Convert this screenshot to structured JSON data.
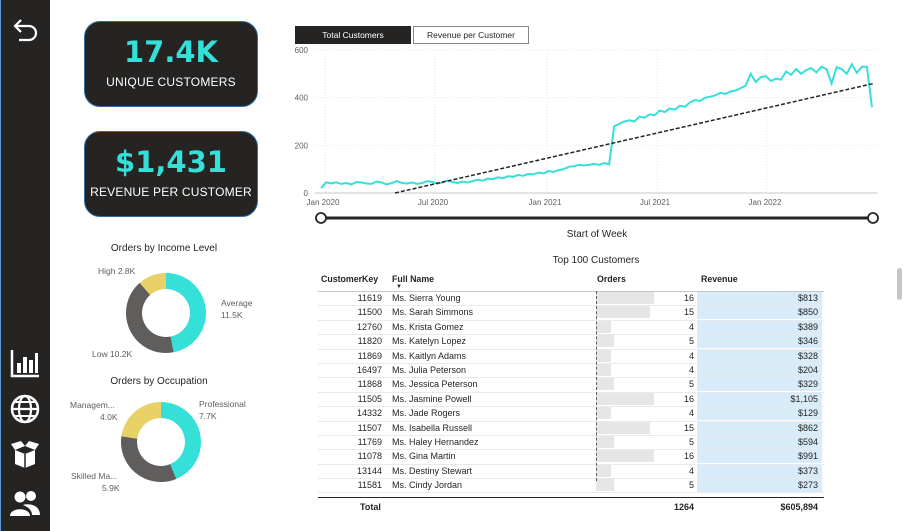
{
  "kpis": {
    "unique_customers": {
      "value": "17.4K",
      "label": "UNIQUE CUSTOMERS"
    },
    "revenue_per_customer": {
      "value": "$1,431",
      "label": "REVENUE PER CUSTOMER"
    }
  },
  "income": {
    "title": "Orders by Income Level",
    "slices": [
      {
        "name": "Average",
        "value": "11.5K",
        "num": 11.5,
        "color": "#35e0d8"
      },
      {
        "name": "Low",
        "value": "10.2K",
        "num": 10.2,
        "color": "#605e5c"
      },
      {
        "name": "High",
        "value": "2.8K",
        "num": 2.8,
        "color": "#e8d166"
      }
    ],
    "labels": {
      "average": "Average",
      "average_val": "11.5K",
      "low": "Low 10.2K",
      "high": "High 2.8K"
    }
  },
  "occupation": {
    "title": "Orders by Occupation",
    "slices": [
      {
        "name": "Professional",
        "value": "7.7K",
        "num": 7.7,
        "color": "#35e0d8"
      },
      {
        "name": "Skilled Ma...",
        "value": "5.9K",
        "num": 5.9,
        "color": "#605e5c"
      },
      {
        "name": "Managem...",
        "value": "4.0K",
        "num": 4.0,
        "color": "#e8d166"
      }
    ],
    "labels": {
      "professional": "Professional",
      "professional_val": "7.7K",
      "skilled": "Skilled Ma...",
      "skilled_val": "5.9K",
      "management": "Managem...",
      "management_val": "4.0K"
    }
  },
  "tabs": {
    "total_customers": "Total Customers",
    "revenue_per_customer": "Revenue per Customer"
  },
  "line_chart": {
    "xlabel": "Start of Week",
    "y_ticks": [
      "0",
      "200",
      "400",
      "600"
    ],
    "x_ticks": [
      "Jan 2020",
      "Jul 2020",
      "Jan 2021",
      "Jul 2021",
      "Jan 2022"
    ]
  },
  "chart_data": {
    "type": "line",
    "title": "",
    "xlabel": "Start of Week",
    "ylabel": "",
    "ylim": [
      0,
      600
    ],
    "x_ticks": [
      "Jan 2020",
      "Jul 2020",
      "Jan 2021",
      "Jul 2021",
      "Jan 2022"
    ],
    "series": [
      {
        "values": [
          20,
          45,
          40,
          45,
          38,
          42,
          36,
          46,
          44,
          40,
          38,
          48,
          44,
          36,
          42,
          50,
          42,
          40,
          44,
          38,
          42,
          50,
          46,
          40,
          44,
          52,
          46,
          42,
          48,
          44,
          50,
          56,
          52,
          60,
          58,
          66,
          62,
          70,
          68,
          76,
          72,
          80,
          78,
          86,
          82,
          92,
          88,
          96,
          100,
          110,
          112,
          118,
          116,
          118,
          122,
          118,
          126,
          120,
          280,
          290,
          300,
          305,
          300,
          320,
          316,
          330,
          326,
          346,
          340,
          354,
          350,
          366,
          362,
          380,
          390,
          386,
          400,
          404,
          410,
          420,
          416,
          426,
          430,
          440,
          450,
          500,
          466,
          486,
          490,
          470,
          480,
          476,
          510,
          496,
          520,
          500,
          516,
          524,
          506,
          530,
          520,
          460,
          528,
          520,
          500,
          540,
          504,
          530,
          530,
          360
        ],
        "color": "#35e0d8"
      },
      {
        "values": [
          0,
          460
        ],
        "color": "#252423"
      }
    ]
  },
  "table": {
    "title": "Top 100 Customers",
    "headers": {
      "key": "CustomerKey",
      "name": "Full Name",
      "orders": "Orders",
      "revenue": "Revenue"
    },
    "rows": [
      {
        "key": "11619",
        "name": "Ms. Sierra Young",
        "orders": "16",
        "orders_num": 16,
        "revenue": "$813",
        "rev_num": 813
      },
      {
        "key": "11500",
        "name": "Ms. Sarah Simmons",
        "orders": "15",
        "orders_num": 15,
        "revenue": "$850",
        "rev_num": 850
      },
      {
        "key": "12760",
        "name": "Ms. Krista Gomez",
        "orders": "4",
        "orders_num": 4,
        "revenue": "$389",
        "rev_num": 389
      },
      {
        "key": "11820",
        "name": "Ms. Katelyn Lopez",
        "orders": "5",
        "orders_num": 5,
        "revenue": "$346",
        "rev_num": 346
      },
      {
        "key": "11869",
        "name": "Ms. Kaitlyn Adams",
        "orders": "4",
        "orders_num": 4,
        "revenue": "$328",
        "rev_num": 328
      },
      {
        "key": "16497",
        "name": "Ms. Julia Peterson",
        "orders": "4",
        "orders_num": 4,
        "revenue": "$204",
        "rev_num": 204
      },
      {
        "key": "11868",
        "name": "Ms. Jessica Peterson",
        "orders": "5",
        "orders_num": 5,
        "revenue": "$329",
        "rev_num": 329
      },
      {
        "key": "11505",
        "name": "Ms. Jasmine Powell",
        "orders": "16",
        "orders_num": 16,
        "revenue": "$1,105",
        "rev_num": 1105
      },
      {
        "key": "14332",
        "name": "Ms. Jade Rogers",
        "orders": "4",
        "orders_num": 4,
        "revenue": "$129",
        "rev_num": 129
      },
      {
        "key": "11507",
        "name": "Ms. Isabella Russell",
        "orders": "15",
        "orders_num": 15,
        "revenue": "$862",
        "rev_num": 862
      },
      {
        "key": "11769",
        "name": "Ms. Haley Hernandez",
        "orders": "5",
        "orders_num": 5,
        "revenue": "$594",
        "rev_num": 594
      },
      {
        "key": "11078",
        "name": "Ms. Gina Martin",
        "orders": "16",
        "orders_num": 16,
        "revenue": "$991",
        "rev_num": 991
      },
      {
        "key": "13144",
        "name": "Ms. Destiny Stewart",
        "orders": "4",
        "orders_num": 4,
        "revenue": "$373",
        "rev_num": 373
      },
      {
        "key": "11581",
        "name": "Ms. Cindy Jordan",
        "orders": "5",
        "orders_num": 5,
        "revenue": "$273",
        "rev_num": 273
      }
    ],
    "total_label": "Total",
    "total_orders": "1264",
    "total_revenue": "$605,894"
  },
  "icons": {
    "back": "back-arrow-icon",
    "chart": "bar-chart-icon",
    "globe": "globe-icon",
    "box": "open-box-icon",
    "users": "users-icon"
  }
}
